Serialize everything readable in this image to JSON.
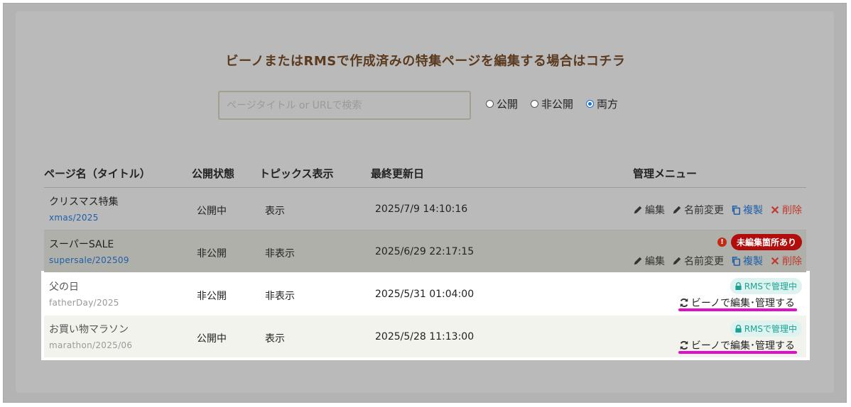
{
  "heading": "ビーノまたはRMSで作成済みの特集ページを編集する場合はコチラ",
  "search": {
    "placeholder": "ページタイトル or URLで検索",
    "value": ""
  },
  "filter": {
    "options": [
      {
        "label": "公開",
        "checked": false
      },
      {
        "label": "非公開",
        "checked": false
      },
      {
        "label": "両方",
        "checked": true
      }
    ]
  },
  "columns": {
    "name": "ページ名（タイトル）",
    "status": "公開状態",
    "topic": "トピックス表示",
    "updated": "最終更新日",
    "menu": "管理メニュー"
  },
  "actions": {
    "edit": "編集",
    "rename": "名前変更",
    "copy": "複製",
    "delete": "削除"
  },
  "rows": [
    {
      "title": "クリスマス特集",
      "slug": "xmas/2025",
      "status": "公開中",
      "topic": "表示",
      "updated": "2025/7/9 14:10:16"
    },
    {
      "title": "スーパーSALE",
      "slug": "supersale/202509",
      "status": "非公開",
      "topic": "非表示",
      "updated": "2025/6/29 22:17:15",
      "badge": "未編集箇所あり",
      "warn": "!"
    },
    {
      "title": "父の日",
      "slug": "fatherDay/2025",
      "status": "非公開",
      "topic": "非表示",
      "updated": "2025/5/31 01:04:00",
      "rms_badge": "RMSで管理中",
      "bino_link": "ビーノで編集･管理する"
    },
    {
      "title": "お買い物マラソン",
      "slug": "marathon/2025/06",
      "status": "公開中",
      "topic": "表示",
      "updated": "2025/5/28 11:13:00",
      "rms_badge": "RMSで管理中",
      "bino_link": "ビーノで編集･管理する"
    }
  ],
  "colors": {
    "highlight": "#e010c8",
    "badge_red": "#b10d0d",
    "rms_teal": "#1aa394",
    "link_blue": "#1f5fa8"
  }
}
